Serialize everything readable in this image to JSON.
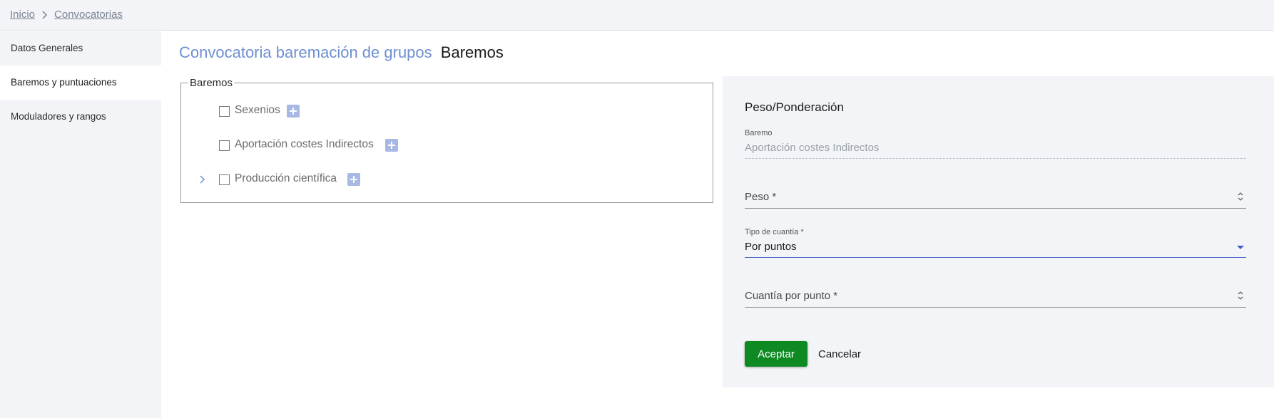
{
  "breadcrumb": {
    "home": "Inicio",
    "current": "Convocatorias"
  },
  "sidebar": {
    "items": [
      {
        "label": "Datos Generales"
      },
      {
        "label": "Baremos y puntuaciones",
        "active": true
      },
      {
        "label": "Moduladores y rangos"
      }
    ]
  },
  "page": {
    "title": "Convocatoria baremación de grupos",
    "subtitle": "Baremos"
  },
  "tree": {
    "legend": "Baremos",
    "items": [
      {
        "label": "Sexenios",
        "checked": false,
        "expandable": false
      },
      {
        "label": "Aportación costes Indirectos",
        "checked": false,
        "expandable": false
      },
      {
        "label": "Producción científica",
        "checked": false,
        "expandable": true
      }
    ]
  },
  "panel": {
    "title": "Peso/Ponderación",
    "baremo_label": "Baremo",
    "baremo_value": "Aportación costes Indirectos",
    "peso_label": "Peso *",
    "tipo_label": "Tipo de cuantía *",
    "tipo_value": "Por puntos",
    "cuantia_label": "Cuantía por punto *",
    "accept": "Aceptar",
    "cancel": "Cancelar"
  },
  "colors": {
    "accent": "#6f8fd1",
    "accept_button": "#0f8a22",
    "plus_button": "#a8b8e4",
    "focus_line": "#3f5fc6"
  }
}
